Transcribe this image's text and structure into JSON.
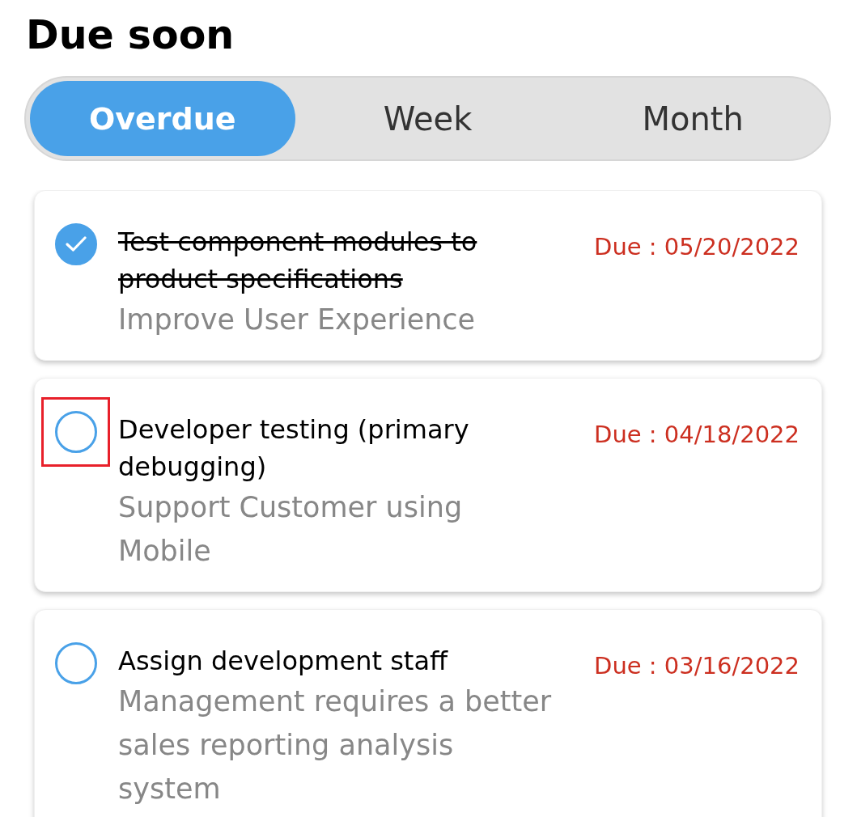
{
  "title": "Due soon",
  "tabs": [
    {
      "label": "Overdue",
      "selected": true
    },
    {
      "label": "Week",
      "selected": false
    },
    {
      "label": "Month",
      "selected": false
    }
  ],
  "tasks": [
    {
      "title": "Test component modules to product specifications",
      "subtitle": "Improve User Experience",
      "due": "Due : 05/20/2022",
      "checked": true,
      "highlighted": false
    },
    {
      "title": "Developer testing (primary debugging)",
      "subtitle": "Support Customer using Mobile",
      "due": "Due : 04/18/2022",
      "checked": false,
      "highlighted": true
    },
    {
      "title": "Assign development staff",
      "subtitle": "Management requires a better sales reporting analysis system",
      "due": "Due : 03/16/2022",
      "checked": false,
      "highlighted": false
    }
  ]
}
